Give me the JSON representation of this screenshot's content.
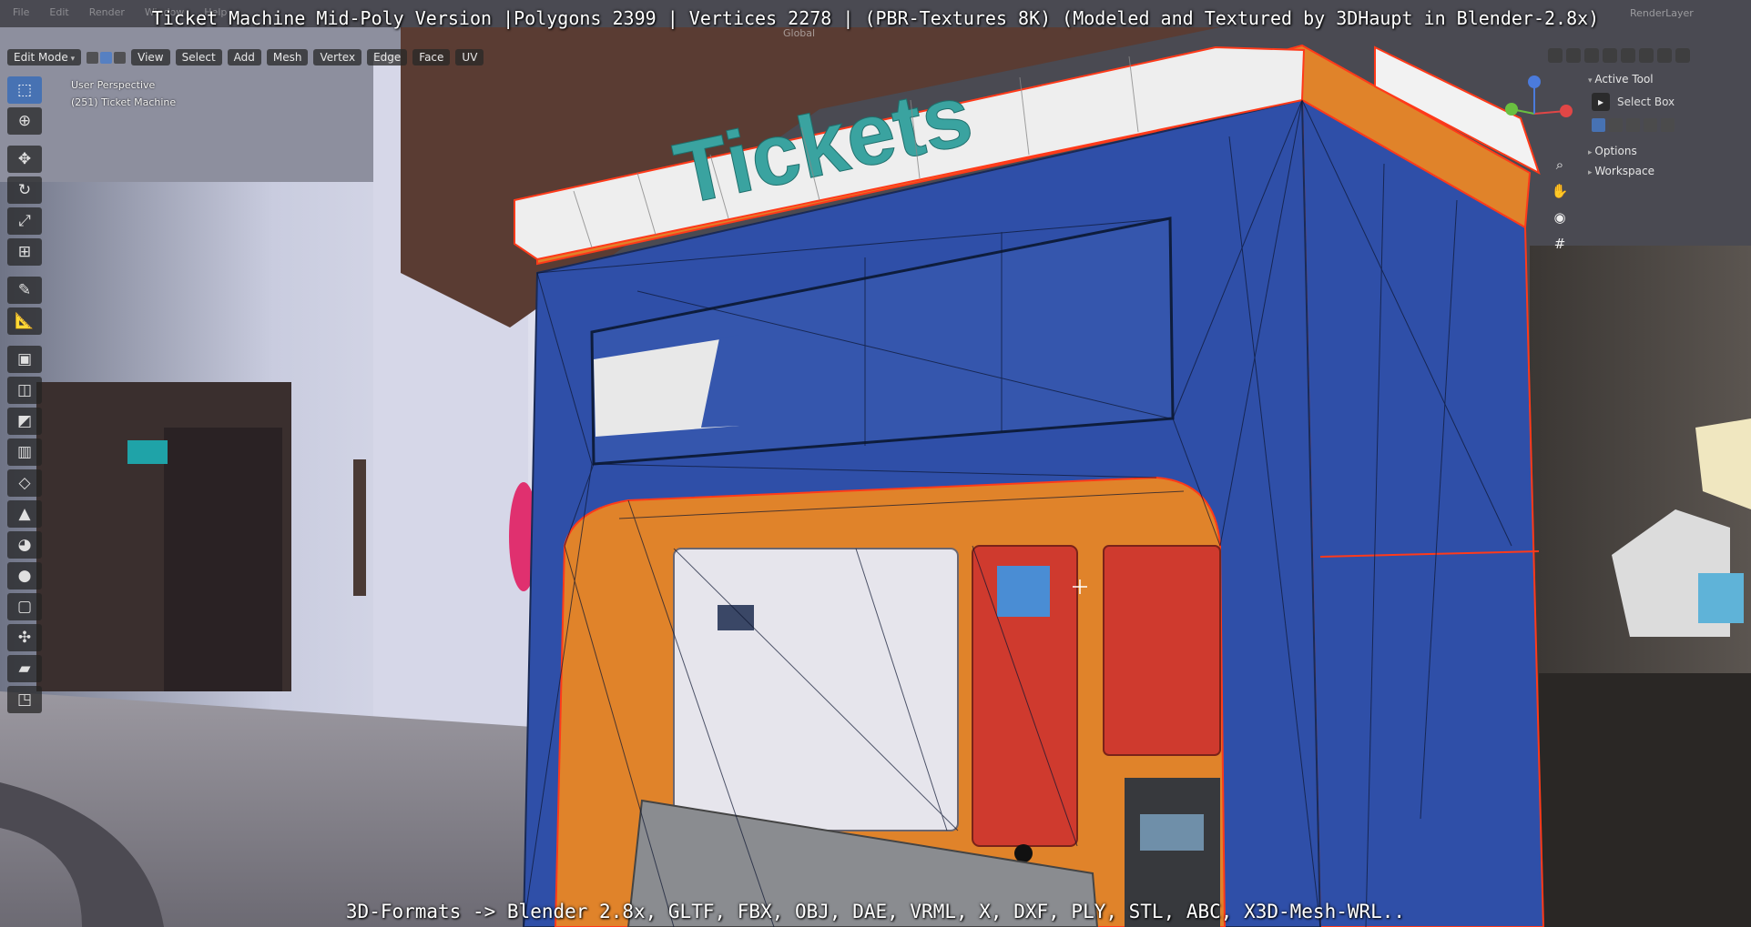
{
  "captions": {
    "title": "Ticket Machine Mid-Poly Version |Polygons 2399 | Vertices 2278 | (PBR-Textures 8K) (Modeled and Textured by 3DHaupt in Blender-2.8x)",
    "formats": "3D-Formats -> Blender 2.8x, GLTF, FBX, OBJ, DAE, VRML, X, DXF, PLY, STL, ABC, X3D-Mesh-WRL.."
  },
  "menubar": {
    "items": [
      "File",
      "Edit",
      "Render",
      "Window",
      "Help"
    ]
  },
  "render_layer": "RenderLayer",
  "viewport_header": {
    "mode": "Edit Mode",
    "menus": [
      "View",
      "Select",
      "Add",
      "Mesh",
      "Vertex",
      "Edge",
      "Face",
      "UV"
    ],
    "orientation": "Global"
  },
  "overlay": {
    "perspective": "User Perspective",
    "object": "(251) Ticket Machine"
  },
  "scene": {
    "sign_text": "Tickets"
  },
  "tool_panel": {
    "active_tool": "Active Tool",
    "select_box": "Select Box",
    "options": "Options",
    "workspace": "Workspace"
  },
  "toolbar_icons": [
    "select-box-icon",
    "cursor-icon",
    "move-icon",
    "rotate-icon",
    "scale-icon",
    "transform-icon",
    "annotate-icon",
    "measure-icon",
    "extrude-icon",
    "inset-icon",
    "bevel-icon",
    "loop-cut-icon",
    "knife-icon",
    "poly-build-icon",
    "spin-icon",
    "smooth-icon",
    "edge-slide-icon",
    "shrink-icon",
    "shear-icon",
    "rip-icon"
  ],
  "colors": {
    "machine_blue": "#2f4fa8",
    "machine_orange": "#e0832a",
    "sign_white": "#eeeeee",
    "sign_text": "#3aa3a0",
    "selection_edge": "#ff3a1a",
    "tool_active": "#4772b3"
  }
}
